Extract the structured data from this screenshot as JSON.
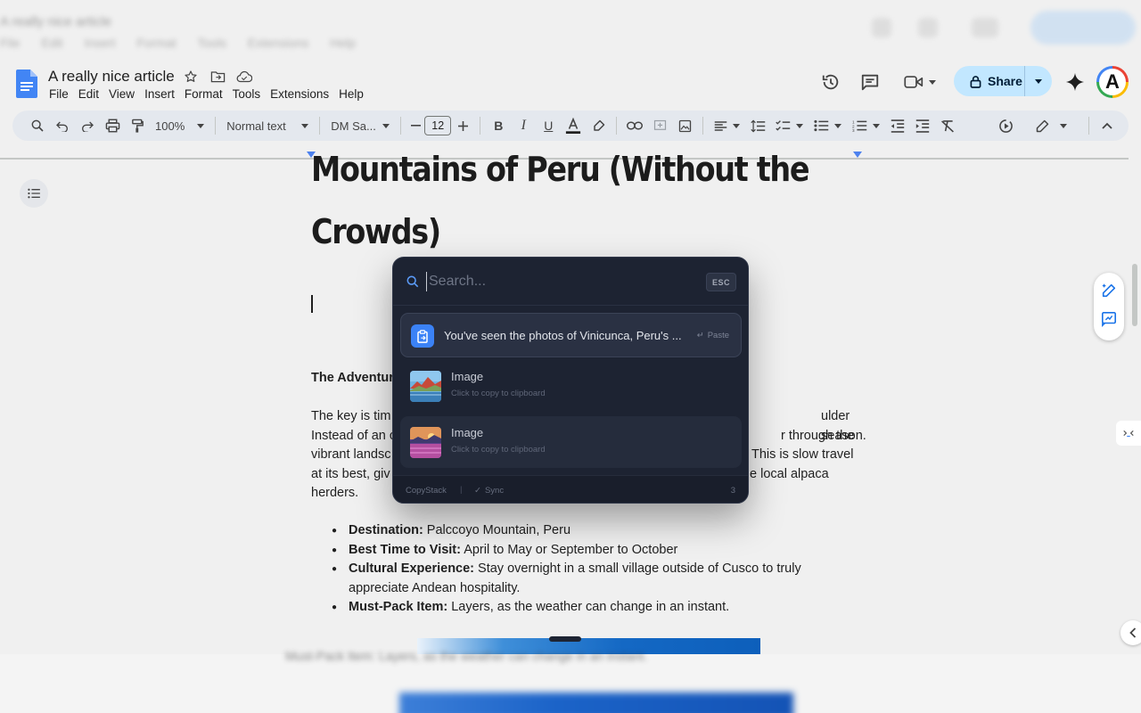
{
  "ghost_window": {
    "title": "A really nice article",
    "menu": "File Edit Insert Format Tools Extensions Help"
  },
  "header": {
    "doc_title": "A really nice article",
    "menu": [
      "File",
      "Edit",
      "View",
      "Insert",
      "Format",
      "Tools",
      "Extensions",
      "Help"
    ],
    "share_label": "Share",
    "avatar_letter": "A"
  },
  "toolbar": {
    "zoom": "100%",
    "style": "Normal text",
    "font": "DM Sa...",
    "font_size": "12"
  },
  "document": {
    "title_line1": "Mountains of Peru (Without the",
    "title_line2": "Crowds)",
    "section_heading": "The Adventur",
    "paragraph": [
      {
        "left": "The key is tim",
        "right": "ulder season."
      },
      {
        "left": "Instead of an c",
        "right": "r through the"
      },
      {
        "left": "vibrant landsc",
        "right": "This is slow travel"
      },
      {
        "left": "at its best, giv",
        "right": "e local alpaca"
      },
      {
        "left": "herders.",
        "right": ""
      }
    ],
    "bullets": [
      {
        "label": "Destination:",
        "text": " Palccoyo Mountain, Peru"
      },
      {
        "label": "Best Time to Visit:",
        "text": " April to May or September to October"
      },
      {
        "label": "Cultural Experience:",
        "text": " Stay overnight in a small village outside of Cusco to truly appreciate Andean hospitality."
      },
      {
        "label": "Must-Pack Item:",
        "text": " Layers, as the weather can change in an instant."
      }
    ],
    "blurred_line": "Must-Pack Item: Layers, as the weather can change in an instant."
  },
  "popup": {
    "search_placeholder": "Search...",
    "esc_label": "ESC",
    "items": [
      {
        "text": "You've seen the photos of Vinicunca, Peru's ...",
        "action": "Paste"
      },
      {
        "title": "Image",
        "subtitle": "Click to copy to clipboard"
      },
      {
        "title": "Image",
        "subtitle": "Click to copy to clipboard"
      }
    ],
    "footer": {
      "brand": "CopyStack",
      "separator": "|",
      "sync": "Sync",
      "count": "3"
    }
  },
  "colors": {
    "share_bg": "#c2e7ff",
    "popup_bg": "#1d2332",
    "accent": "#3b82f6"
  }
}
